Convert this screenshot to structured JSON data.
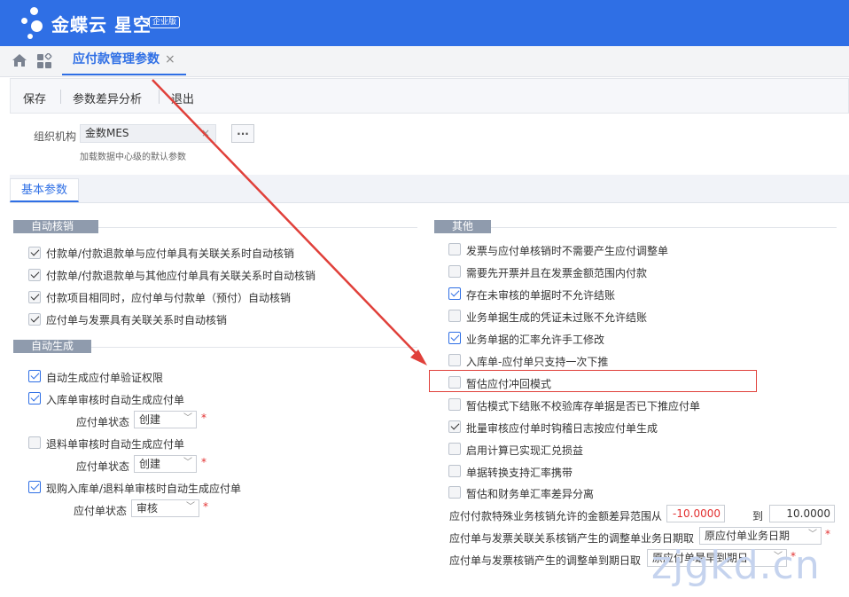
{
  "brand": {
    "name": "金蝶云 星空",
    "badge": "企业版"
  },
  "tabs": {
    "active_label": "应付款管理参数",
    "close_glyph": "×"
  },
  "toolbar": {
    "save": "保存",
    "diff": "参数差异分析",
    "exit": "退出"
  },
  "org": {
    "label": "组织机构",
    "value": "金数MES",
    "clear_glyph": "×",
    "more": "...",
    "hint": "加载数据中心级的默认参数"
  },
  "subtabs": {
    "basic": "基本参数"
  },
  "auto_verify": {
    "title": "自动核销",
    "items": [
      {
        "label": "付款单/付款退款单与应付单具有关联关系时自动核销",
        "checked": true
      },
      {
        "label": "付款单/付款退款单与其他应付单具有关联关系时自动核销",
        "checked": true
      },
      {
        "label": "付款项目相同时，应付单与付款单（预付）自动核销",
        "checked": true
      },
      {
        "label": "应付单与发票具有关联关系时自动核销",
        "checked": true
      }
    ]
  },
  "auto_gen": {
    "title": "自动生成",
    "items": [
      {
        "label": "自动生成应付单验证权限",
        "checked": true
      },
      {
        "label": "入库单审核时自动生成应付单",
        "checked": true
      },
      {
        "label": "退料单审核时自动生成应付单",
        "checked": false
      },
      {
        "label": "现购入库单/退料单审核时自动生成应付单",
        "checked": true
      }
    ],
    "status_label": "应付单状态",
    "status1": "创建",
    "status2": "创建",
    "status3": "审核",
    "required": "*"
  },
  "other": {
    "title": "其他",
    "items": [
      {
        "label": "发票与应付单核销时不需要产生应付调整单",
        "checked": false
      },
      {
        "label": "需要先开票并且在发票金额范围内付款",
        "checked": false
      },
      {
        "label": "存在未审核的单据时不允许结账",
        "checked": true
      },
      {
        "label": "业务单据生成的凭证未过账不允许结账",
        "checked": false
      },
      {
        "label": "业务单据的汇率允许手工修改",
        "checked": true
      },
      {
        "label": "入库单-应付单只支持一次下推",
        "checked": false
      },
      {
        "label": "暂估应付冲回模式",
        "checked": false
      },
      {
        "label": "暂估模式下结账不校验库存单据是否已下推应付单",
        "checked": false
      },
      {
        "label": "批量审核应付单时钩稽日志按应付单生成",
        "checked": true
      },
      {
        "label": "启用计算已实现汇兑损益",
        "checked": false
      },
      {
        "label": "单据转换支持汇率携带",
        "checked": false
      },
      {
        "label": "暂估和财务单汇率差异分离",
        "checked": false
      }
    ],
    "range_label": "应付付款特殊业务核销允许的金额差异范围从",
    "range_from": "-10.0000",
    "range_to_label": "到",
    "range_to": "10.0000",
    "adj_business_label": "应付单与发票关联关系核销产生的调整单业务日期取",
    "adj_business_value": "原应付单业务日期",
    "adj_due_label": "应付单与发票核销产生的调整单到期日取",
    "adj_due_value": "原应付单最早到期日",
    "required": "*"
  },
  "watermark": "zjgkd.cn",
  "colors": {
    "brand_blue": "#2f6fe5",
    "highlight_red": "#e0403a",
    "group_header": "#8f9bad"
  }
}
